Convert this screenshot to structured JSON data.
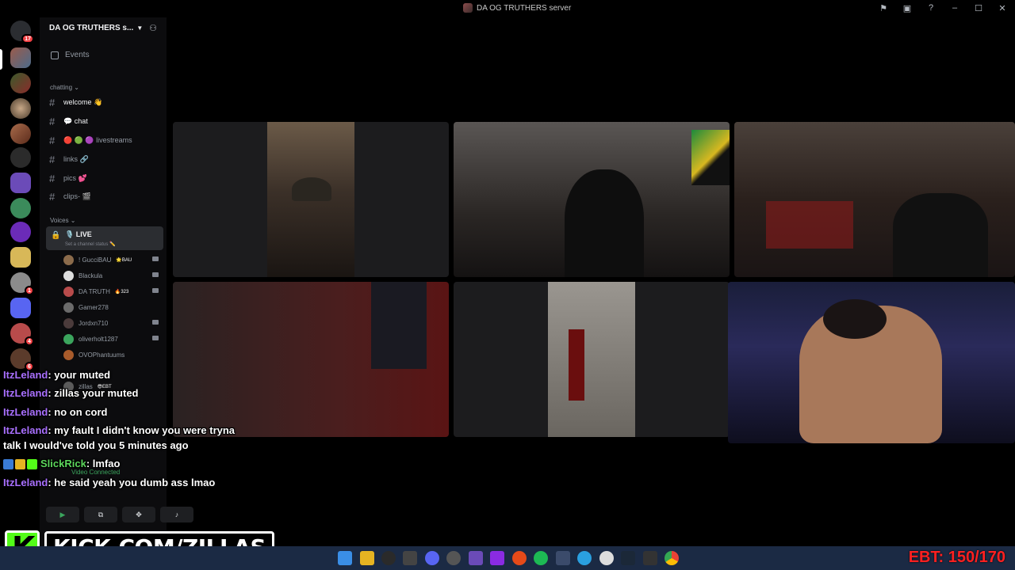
{
  "window": {
    "title": "DA OG TRUTHERS server"
  },
  "rail": {
    "home_badge": "17",
    "badges": [
      "4",
      "6",
      "1"
    ]
  },
  "sidebar": {
    "server_name": "DA OG TRUTHERS s...",
    "events_label": "Events",
    "categories": {
      "chatting": "chatting",
      "voices": "Voices"
    },
    "channels": [
      {
        "label": "welcome 👋"
      },
      {
        "label": "💬 chat"
      },
      {
        "label": "🔴 🟢 🟣 livestreams"
      },
      {
        "label": "links 🔗"
      },
      {
        "label": "pics 💕"
      },
      {
        "label": "clips- 🎬"
      }
    ],
    "voice_channel": {
      "name": "🎙️ LIVE",
      "status": "Set a channel status ✏️"
    },
    "voice_users": [
      {
        "name": "! GucciBAU",
        "tag": "🌟BAU"
      },
      {
        "name": "Blackula",
        "tag": ""
      },
      {
        "name": "DA TRUTH",
        "tag": "🔥323"
      },
      {
        "name": "Gamer278",
        "tag": ""
      },
      {
        "name": "Jordxn710",
        "tag": ""
      },
      {
        "name": "oliverholt1287",
        "tag": ""
      },
      {
        "name": "OVOPhantuums",
        "tag": ""
      },
      {
        "name": "zillas",
        "tag": "😎EBT"
      }
    ],
    "video_connected": "Video Connected"
  },
  "chat": [
    {
      "user": "ItzLeland",
      "text": "your muted"
    },
    {
      "user": "ItzLeland",
      "text": "zillas your muted"
    },
    {
      "user": "ItzLeland",
      "text": "no on cord"
    },
    {
      "user": "ItzLeland",
      "text": "my fault I didn't know you were tryna"
    },
    {
      "user": "",
      "text": "talk I would've told you 5 minutes ago"
    },
    {
      "user": "SlickRick",
      "text": "lmfao"
    },
    {
      "user": "ItzLeland",
      "text": "he said yeah you dumb ass lmao"
    }
  ],
  "branding": {
    "kick_url": "KICK.COM/ZILLAS"
  },
  "overlay": {
    "ebt_counter": "EBT: 150/170"
  },
  "colors": {
    "kick_green": "#53fc18",
    "chat_user": "#a970ff",
    "counter_red": "#ff2020",
    "discord_green": "#3ba55d"
  }
}
